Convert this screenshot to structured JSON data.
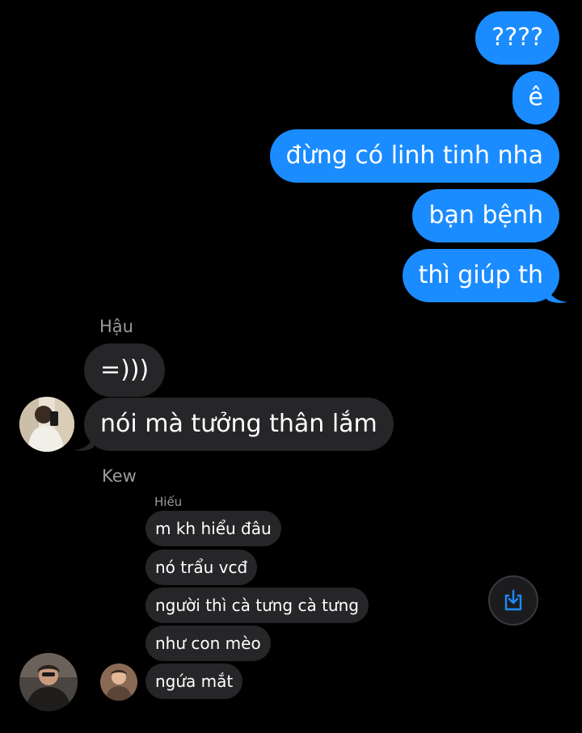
{
  "colors": {
    "outgoing_bubble": "#1b8cff",
    "incoming_bubble": "#262629",
    "background": "#000000",
    "sender_name": "#9a9a9e",
    "share_icon": "#1b8cff"
  },
  "outgoing_messages": [
    "????",
    "ê",
    "đừng có linh tinh nha",
    "bạn bệnh",
    "thì giúp th"
  ],
  "group_1": {
    "sender": "Hậu",
    "messages": [
      "=)))",
      "nói mà tưởng thân lắm"
    ]
  },
  "group_2": {
    "sender": "Kew",
    "forwarded_sender": "Hiếu",
    "messages": [
      "m kh hiểu đâu",
      "nó trẩu vcđ",
      "người thì cà tưng cà tưng",
      "như con mèo",
      "ngứa mắt"
    ]
  },
  "share_button": {
    "icon": "share-download-icon"
  }
}
